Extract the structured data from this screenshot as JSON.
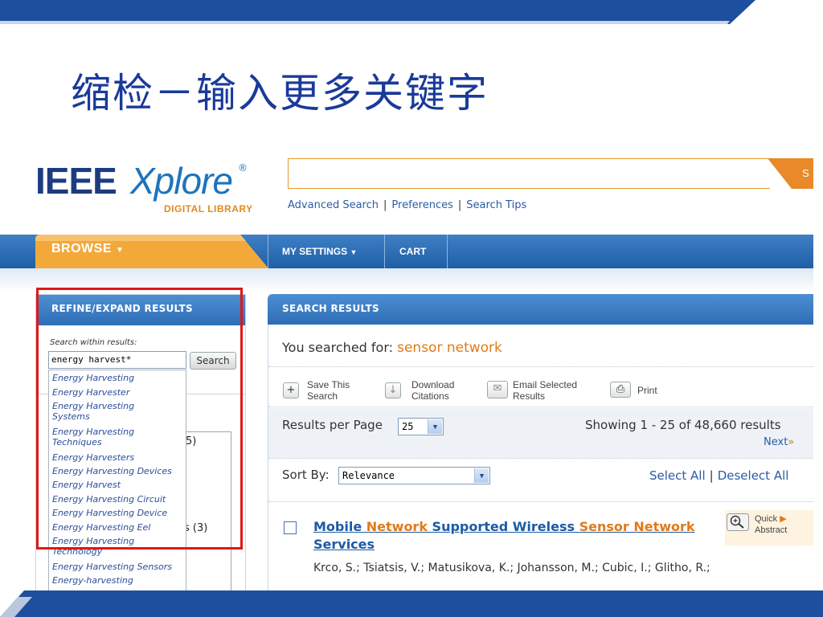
{
  "slide": {
    "title": "缩检－输入更多关键字"
  },
  "header": {
    "logo_ieee": "IEEE",
    "logo_xplore": "Xplore",
    "logo_reg": "®",
    "logo_sub": "DIGITAL LIBRARY",
    "search_button": "S",
    "links": [
      "Advanced Search",
      "Preferences",
      "Search Tips"
    ]
  },
  "nav": {
    "browse": "BROWSE",
    "my_settings": "MY SETTINGS",
    "cart": "CART"
  },
  "refine": {
    "title": "REFINE/EXPAND RESULTS",
    "search_within_label": "Search within results:",
    "search_within_value": "energy harvest*",
    "search_button": "Search",
    "partial_counts": [
      "5)",
      "s (3)"
    ],
    "suggestions": [
      "Energy Harvesting",
      "Energy Harvester",
      "Energy Harvesting Systems",
      "Energy Harvesting Techniques",
      "Energy Harvesters",
      "Energy Harvesting Devices",
      "Energy Harvest",
      "Energy Harvesting Circuit",
      "Energy Harvesting Device",
      "Energy Harvesting Eel",
      "Energy Harvesting Technology",
      "Energy Harvesting Sensors",
      "Energy-harvesting"
    ]
  },
  "results": {
    "title": "SEARCH RESULTS",
    "searched_prefix": "You searched for:",
    "searched_term": "sensor network",
    "tools": {
      "save_line1": "Save This",
      "save_line2": "Search",
      "download_line1": "Download",
      "download_line2": "Citations",
      "email_line1": "Email Selected",
      "email_line2": "Results",
      "print": "Print"
    },
    "per_page_label": "Results per Page",
    "per_page_value": "25",
    "showing": "Showing 1 - 25 of 48,660 results",
    "next": "Next",
    "next_glyph": "»",
    "sort_label": "Sort By:",
    "sort_value": "Relevance",
    "select_all": "Select All",
    "deselect_all": "Deselect All",
    "item": {
      "title_parts": [
        {
          "text": "Mobile ",
          "hl": false
        },
        {
          "text": "Network",
          "hl": true
        },
        {
          "text": " Supported Wireless ",
          "hl": false
        },
        {
          "text": "Sensor Network",
          "hl": true
        },
        {
          "text": " Services",
          "hl": false
        }
      ],
      "authors": "Krco, S.; Tsiatsis, V.; Matusikova, K.; Johansson, M.; Cubic, I.; Glitho, R.;",
      "quick_line1": "Quick",
      "quick_line2": "Abstract"
    }
  },
  "colors": {
    "accent_orange": "#e07a1a",
    "nav_blue": "#2e6db5",
    "link_blue": "#2a5ba8",
    "title_blue": "#1a3a9a",
    "highlight_red": "#e01818"
  }
}
